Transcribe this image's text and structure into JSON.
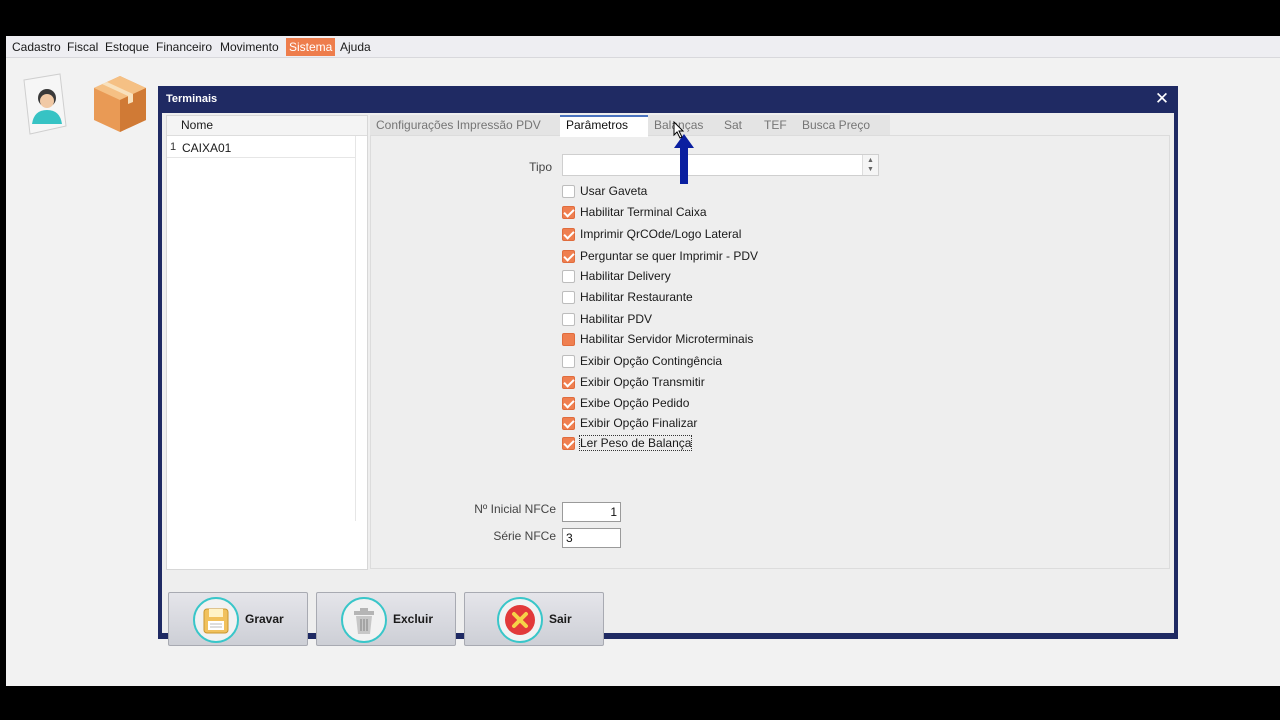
{
  "menu": {
    "items": [
      {
        "label": "Cadastro",
        "active": false
      },
      {
        "label": "Fiscal",
        "active": false
      },
      {
        "label": "Estoque",
        "active": false
      },
      {
        "label": "Financeiro",
        "active": false
      },
      {
        "label": "Movimento",
        "active": false
      },
      {
        "label": "Sistema",
        "active": true
      },
      {
        "label": "Ajuda",
        "active": false
      }
    ]
  },
  "toolbar": {
    "icons": [
      "user-icon",
      "package-icon"
    ]
  },
  "dialog": {
    "title": "Terminais",
    "close_label": "✕",
    "grid": {
      "column_header": "Nome",
      "rows": [
        {
          "num": "1",
          "name": "CAIXA01"
        }
      ]
    },
    "tabs": [
      {
        "label": "Configurações Impressão  PDV",
        "active": false
      },
      {
        "label": "Parâmetros",
        "active": true
      },
      {
        "label": "Balanças",
        "active": false
      },
      {
        "label": "Sat",
        "active": false
      },
      {
        "label": "TEF",
        "active": false
      },
      {
        "label": "Busca Preço",
        "active": false
      }
    ],
    "tipo_label": "Tipo",
    "tipo_value": "",
    "checkboxes": [
      {
        "label": "Usar Gaveta",
        "state": "unchecked"
      },
      {
        "label": "Habilitar Terminal Caixa",
        "state": "checked"
      },
      {
        "label": "Imprimir QrCOde/Logo Lateral",
        "state": "checked"
      },
      {
        "label": "Perguntar se quer Imprimir - PDV",
        "state": "checked"
      },
      {
        "label": "Habilitar Delivery",
        "state": "unchecked"
      },
      {
        "label": "Habilitar Restaurante",
        "state": "unchecked"
      },
      {
        "label": "Habilitar PDV",
        "state": "unchecked"
      },
      {
        "label": "Habilitar Servidor Microterminais",
        "state": "indeterminate"
      },
      {
        "label": "Exibir Opção Contingência",
        "state": "unchecked"
      },
      {
        "label": "Exibir Opção Transmitir",
        "state": "checked"
      },
      {
        "label": "Exibe Opção Pedido",
        "state": "checked"
      },
      {
        "label": "Exibir Opção Finalizar",
        "state": "checked"
      },
      {
        "label": "Ler Peso de Balança",
        "state": "checked"
      }
    ],
    "nfce_inicial_label": "Nº Inicial NFCe",
    "nfce_inicial_value": "1",
    "serie_nfce_label": "Série NFCe",
    "serie_nfce_value": "3",
    "buttons": {
      "gravar": "Gravar",
      "excluir": "Excluir",
      "sair": "Sair"
    }
  },
  "colors": {
    "accent": "#ef7f50",
    "dialog_frame": "#1f2a63",
    "arrow": "#0a1fa0",
    "button_ring": "#39c6c9"
  }
}
